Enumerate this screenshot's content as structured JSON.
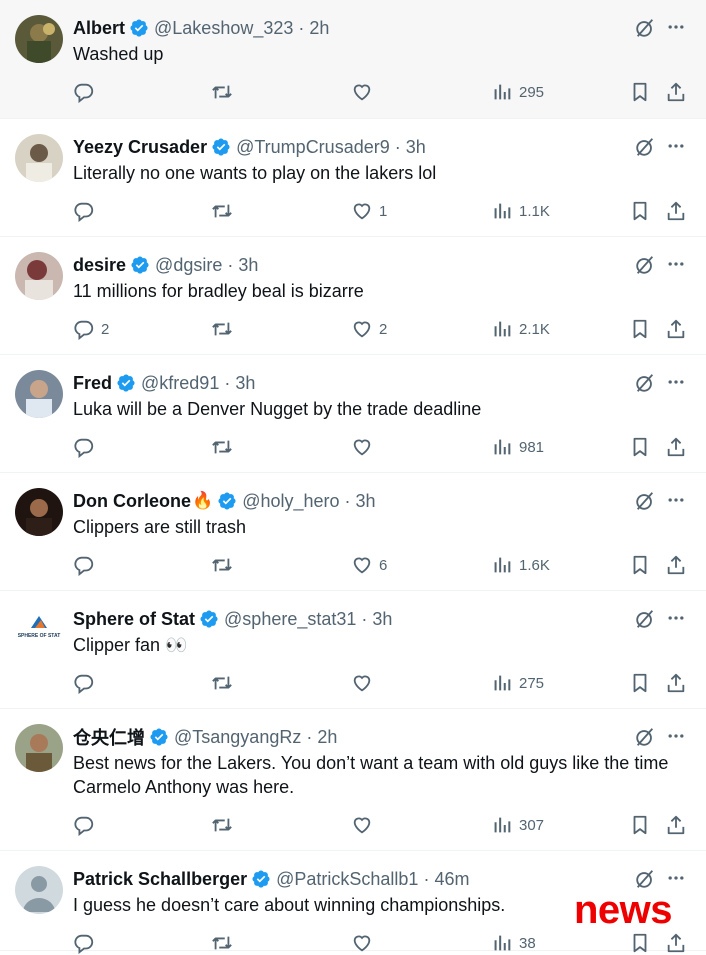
{
  "colors": {
    "verified": "#1d9bf0",
    "icon_gray": "#536471",
    "text": "#0f1419",
    "watermark": "#ee0000"
  },
  "icons": {
    "reply": "reply-icon",
    "retweet": "retweet-icon",
    "like": "heart-icon",
    "views": "views-icon",
    "bookmark": "bookmark-icon",
    "share": "share-icon",
    "more": "more-icon",
    "grok": "grok-icon",
    "verified": "verified-badge-icon"
  },
  "tweets": [
    {
      "name": "Albert",
      "name_emoji": "",
      "handle": "@Lakeshow_323",
      "time": "2h",
      "text": "Washed up",
      "replies": "",
      "likes": "",
      "views": "295"
    },
    {
      "name": "Yeezy Crusader",
      "name_emoji": "",
      "handle": "@TrumpCrusader9",
      "time": "3h",
      "text": "Literally no one wants to play on the lakers lol",
      "replies": "",
      "likes": "1",
      "views": "1.1K"
    },
    {
      "name": "desire",
      "name_emoji": "",
      "handle": "@dgsire",
      "time": "3h",
      "text": "11 millions for bradley beal is bizarre",
      "replies": "2",
      "likes": "2",
      "views": "2.1K"
    },
    {
      "name": "Fred",
      "name_emoji": "",
      "handle": "@kfred91",
      "time": "3h",
      "text": "Luka will be a Denver Nugget by the trade deadline",
      "replies": "",
      "likes": "",
      "views": "981"
    },
    {
      "name": "Don Corleone",
      "name_emoji": "🔥",
      "handle": "@holy_hero",
      "time": "3h",
      "text": "Clippers are still trash",
      "replies": "",
      "likes": "6",
      "views": "1.6K"
    },
    {
      "name": "Sphere of Stat",
      "name_emoji": "",
      "handle": "@sphere_stat31",
      "time": "3h",
      "text": "Clipper fan 👀",
      "replies": "",
      "likes": "",
      "views": "275",
      "avatar_text": "SPHERE OF STAT"
    },
    {
      "name": "仓央仁增",
      "name_emoji": "",
      "handle": "@TsangyangRz",
      "time": "2h",
      "text": "Best news for the Lakers. You don’t want a team with old guys like the time Carmelo Anthony was here.",
      "replies": "",
      "likes": "",
      "views": "307"
    },
    {
      "name": "Patrick Schallberger",
      "name_emoji": "",
      "handle": "@PatrickSchallb1",
      "time": "46m",
      "text": "I guess he doesn’t care about winning championships.",
      "replies": "",
      "likes": "",
      "views": "38"
    }
  ],
  "watermark": "news"
}
